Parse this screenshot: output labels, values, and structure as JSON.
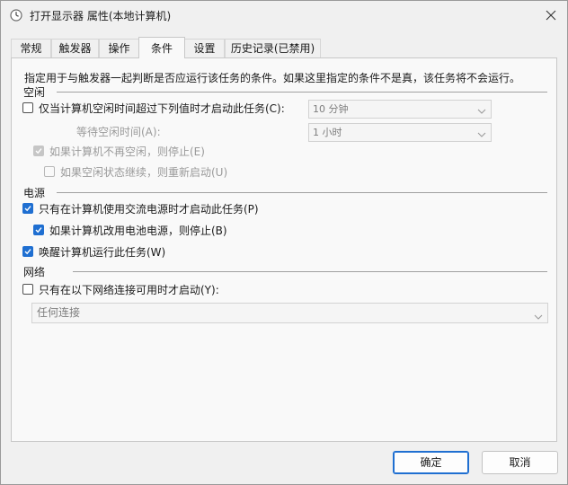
{
  "window": {
    "title": "打开显示器 属性(本地计算机)"
  },
  "tabs": [
    {
      "label": "常规"
    },
    {
      "label": "触发器"
    },
    {
      "label": "操作"
    },
    {
      "label": "条件",
      "active": true
    },
    {
      "label": "设置"
    },
    {
      "label": "历史记录(已禁用)"
    }
  ],
  "conditions": {
    "description": "指定用于与触发器一起判断是否应运行该任务的条件。如果这里指定的条件不是真，该任务将不会运行。",
    "idle": {
      "heading": "空闲",
      "start_only_if_idle": {
        "label": "仅当计算机空闲时间超过下列值时才启动此任务(C):",
        "checked": false,
        "value": "10 分钟"
      },
      "wait_for_idle": {
        "label": "等待空闲时间(A):",
        "value": "1 小时"
      },
      "stop_if_not_idle": {
        "label": "如果计算机不再空闲，则停止(E)",
        "checked": true,
        "enabled": false
      },
      "restart_if_idle_resumes": {
        "label": "如果空闲状态继续，则重新启动(U)",
        "checked": false,
        "enabled": false
      }
    },
    "power": {
      "heading": "电源",
      "start_only_on_ac": {
        "label": "只有在计算机使用交流电源时才启动此任务(P)",
        "checked": true
      },
      "stop_on_battery": {
        "label": "如果计算机改用电池电源，则停止(B)",
        "checked": true
      },
      "wake_to_run": {
        "label": "唤醒计算机运行此任务(W)",
        "checked": true
      }
    },
    "network": {
      "heading": "网络",
      "start_only_if_network": {
        "label": "只有在以下网络连接可用时才启动(Y):",
        "checked": false
      },
      "connection": "任何连接"
    }
  },
  "buttons": {
    "ok": "确定",
    "cancel": "取消"
  },
  "colors": {
    "accent": "#1f6fd1",
    "disabled_text": "#9a9a9a"
  }
}
